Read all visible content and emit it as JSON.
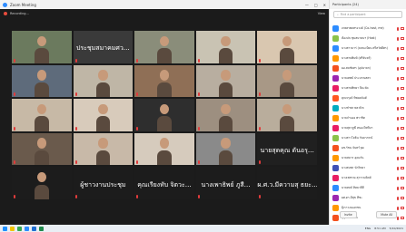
{
  "window": {
    "title": "Zoom Meeting",
    "min": "—",
    "max": "□",
    "close": "✕"
  },
  "recording": {
    "label": "Recording..."
  },
  "view": {
    "label": "View"
  },
  "tiles": [
    {
      "bg": "#6b7a5e",
      "name": "",
      "big": ""
    },
    {
      "bg": "#3a3a3a",
      "name": "",
      "big": "ประชุมสมาคมศว…"
    },
    {
      "bg": "#8a8d7a",
      "name": "",
      "big": ""
    },
    {
      "bg": "#c9c3b3",
      "name": "",
      "big": ""
    },
    {
      "bg": "#d9c7b0",
      "name": "",
      "big": ""
    },
    {
      "bg": "#5e6b7b",
      "name": "",
      "big": ""
    },
    {
      "bg": "#bfb6a6",
      "name": "",
      "big": ""
    },
    {
      "bg": "#8f6f56",
      "name": "",
      "big": ""
    },
    {
      "bg": "#b8aea0",
      "name": "",
      "big": ""
    },
    {
      "bg": "#a89886",
      "name": "",
      "big": ""
    },
    {
      "bg": "#c7b9a6",
      "name": "",
      "big": ""
    },
    {
      "bg": "#d8cbbb",
      "name": "",
      "big": ""
    },
    {
      "bg": "#2e2e2e",
      "name": "",
      "big": ""
    },
    {
      "bg": "#9d8f80",
      "name": "",
      "big": ""
    },
    {
      "bg": "#b9ad9c",
      "name": "",
      "big": ""
    },
    {
      "bg": "#6a5a4c",
      "name": "",
      "big": ""
    },
    {
      "bg": "#c8b9a8",
      "name": "",
      "big": ""
    },
    {
      "bg": "#d6cbbd",
      "name": "",
      "big": ""
    },
    {
      "bg": "#8a8a8a",
      "name": "",
      "big": ""
    },
    {
      "bg": "#202020",
      "name": "",
      "big": "นายสุดคุณ ดันอรุ…"
    },
    {
      "bg": "#1c1c1c",
      "name": "",
      "big": ""
    },
    {
      "bg": "#1c1c1c",
      "name": "",
      "big": "ผู้ชาวงานประชุม"
    },
    {
      "bg": "#1c1c1c",
      "name": "",
      "big": "คุณเรียงทับ จิตวะ…"
    },
    {
      "bg": "#1c1c1c",
      "name": "",
      "big": "นางเพาธิพย์ ภูสี…"
    },
    {
      "bg": "#1c1c1c",
      "name": "",
      "big": "ผ.ศ.ว.มีความสุ ธยะ…"
    }
  ],
  "participants_panel": {
    "title": "Participants (24)",
    "search_placeholder": "Find a participant",
    "participants": [
      {
        "name": "เกษตรพลทรงวงค์ (Co-host, me)",
        "color": "#2d8cff"
      },
      {
        "name": "ห้องประชุมสมาคมฯ (Host)",
        "color": "#8bc34a"
      },
      {
        "name": "นางสาวมาร่ (ลงทะเบียน ศรีสวัสดิ์ศร)",
        "color": "#2d8cff"
      },
      {
        "name": "นางสายพิมพ์ (ศรีจันทร์)",
        "color": "#ff9800"
      },
      {
        "name": "ผอ.สมชัยทร (อุปนายก)",
        "color": "#f4511e"
      },
      {
        "name": "นายเทพย์ ประมาณสตร",
        "color": "#9c27b0"
      },
      {
        "name": "นางสายพิทยา ปิยะจัด",
        "color": "#e91e63"
      },
      {
        "name": "คุณจรุงค์ ทิพยอนันต์",
        "color": "#ff5722"
      },
      {
        "name": "นางชำพร พลวนิช",
        "color": "#00acc1"
      },
      {
        "name": "นายจำนอง พราชิต",
        "color": "#ff9800"
      },
      {
        "name": "นายสุธาฎฬ์ หนองโพทีมา",
        "color": "#e91e63"
      },
      {
        "name": "นางสาวโยธิน กันยาภรณ์",
        "color": "#8bc34a"
      },
      {
        "name": "ผช.รัชน จันทร์วุฒ",
        "color": "#f4511e"
      },
      {
        "name": "นายสมาร อุดมวัน",
        "color": "#ff9800"
      },
      {
        "name": "นางสมพร นักวิทยา",
        "color": "#3f51b5"
      },
      {
        "name": "นางเพชรณ สุวรรณจิตต์",
        "color": "#e91e63"
      },
      {
        "name": "นายทลล์ ทิตยวลีที",
        "color": "#2d8cff"
      },
      {
        "name": "ผศ.ดร.มีสุข ทีซะ",
        "color": "#9c27b0"
      },
      {
        "name": "ผุ้เราวงนเอกชน",
        "color": "#ff9800"
      },
      {
        "name": "สุอุราวงนะกะ",
        "color": "#f4511e"
      }
    ],
    "invite_label": "Invite",
    "mute_label": "Mute All"
  },
  "taskbar": {
    "lang": "ENG",
    "time": "8:51 AM",
    "date": "5/10/2021"
  }
}
